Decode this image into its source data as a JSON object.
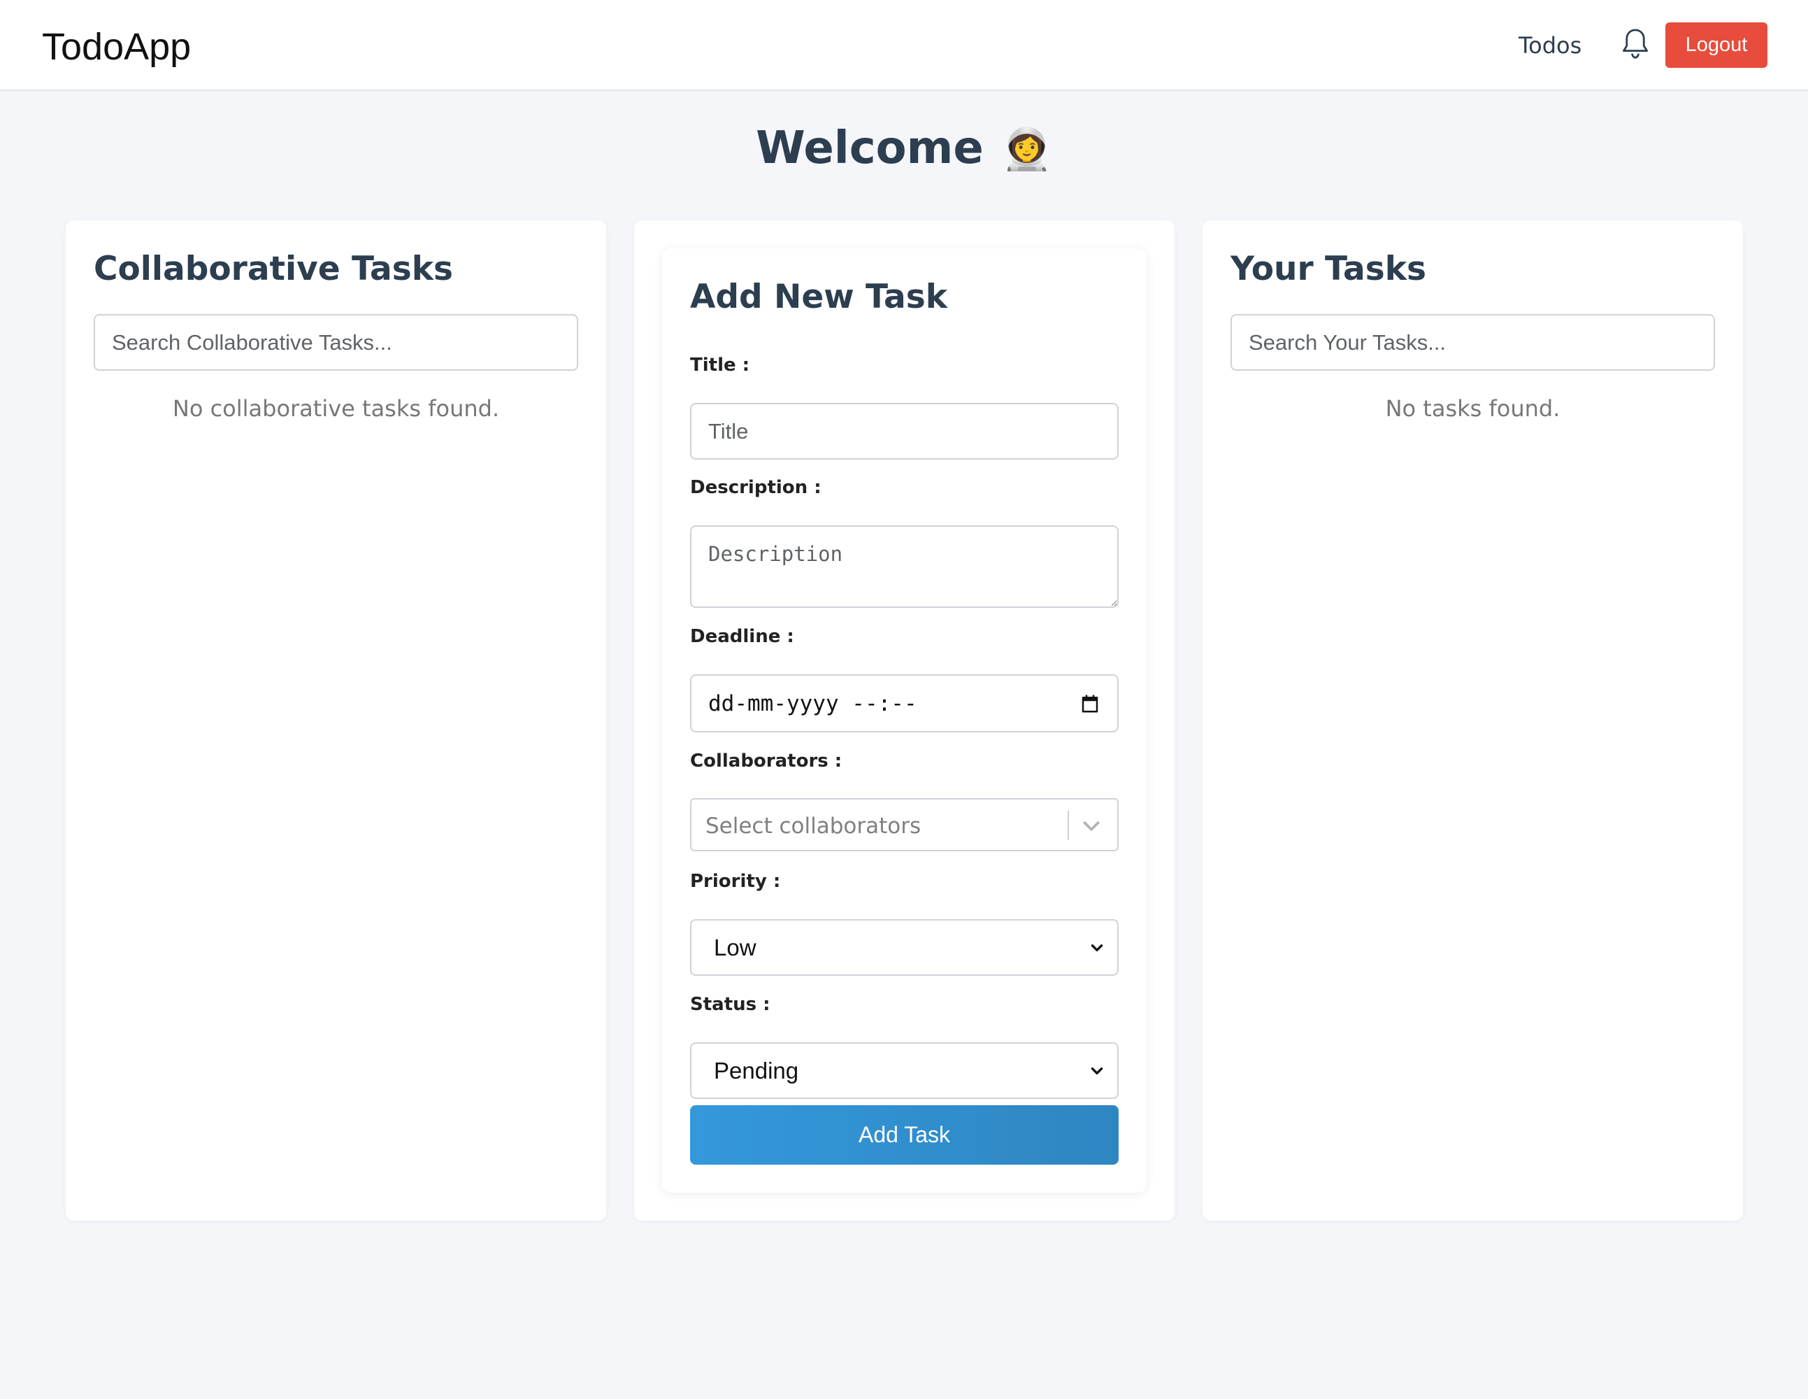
{
  "navbar": {
    "brand": "TodoApp",
    "todos_link": "Todos",
    "bell_icon": "bell-icon",
    "logout_label": "Logout",
    "logout_color": "#e74c3c"
  },
  "welcome": {
    "text": "Welcome",
    "emoji": "👩‍🚀"
  },
  "collaborative": {
    "title": "Collaborative Tasks",
    "search_placeholder": "Search Collaborative Tasks...",
    "empty_text": "No collaborative tasks found."
  },
  "form": {
    "title": "Add New Task",
    "title_label": "Title :",
    "title_placeholder": "Title",
    "description_label": "Description :",
    "description_placeholder": "Description",
    "deadline_label": "Deadline :",
    "deadline_value": "dd-mm-yyyy --:--",
    "calendar_icon": "calendar-icon",
    "collaborators_label": "Collaborators :",
    "collaborators_placeholder": "Select collaborators",
    "priority_label": "Priority :",
    "priority_value": "Low",
    "status_label": "Status :",
    "status_value": "Pending",
    "submit_label": "Add Task",
    "submit_color": "#3498db"
  },
  "your_tasks": {
    "title": "Your Tasks",
    "search_placeholder": "Search Your Tasks...",
    "empty_text": "No tasks found."
  }
}
